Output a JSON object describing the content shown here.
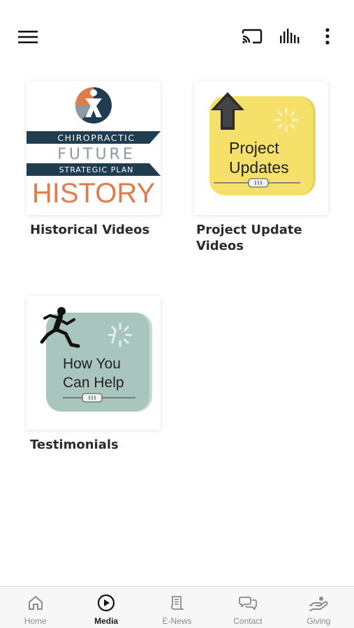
{
  "header": {
    "menu_icon": "hamburger-menu-icon",
    "cast_icon": "cast-icon",
    "audio_icon": "equalizer-icon",
    "more_icon": "more-vertical-icon"
  },
  "tiles": [
    {
      "label": "Historical Videos",
      "thumb": {
        "line1": "CHIROPRACTIC",
        "line2": "FUTURE",
        "line3": "STRATEGIC PLAN",
        "line4": "HISTORY",
        "band_color": "#1f3d4f",
        "accent_color": "#e07b4c"
      }
    },
    {
      "label": "Project Update Videos",
      "thumb": {
        "line1": "Project",
        "line2": "Updates",
        "bg_color": "#f5e06a",
        "icon": "arrow-up-icon"
      }
    },
    {
      "label": "Testimonials",
      "thumb": {
        "line1": "How You",
        "line2": "Can Help",
        "bg_color": "#a8c6bd",
        "icon": "running-person-icon"
      }
    }
  ],
  "nav": {
    "items": [
      {
        "label": "Home",
        "icon": "home-icon"
      },
      {
        "label": "Media",
        "icon": "play-circle-icon",
        "active": true
      },
      {
        "label": "E-News",
        "icon": "news-scroll-icon"
      },
      {
        "label": "Contact",
        "icon": "chat-bubbles-icon"
      },
      {
        "label": "Giving",
        "icon": "giving-hand-icon"
      }
    ]
  }
}
